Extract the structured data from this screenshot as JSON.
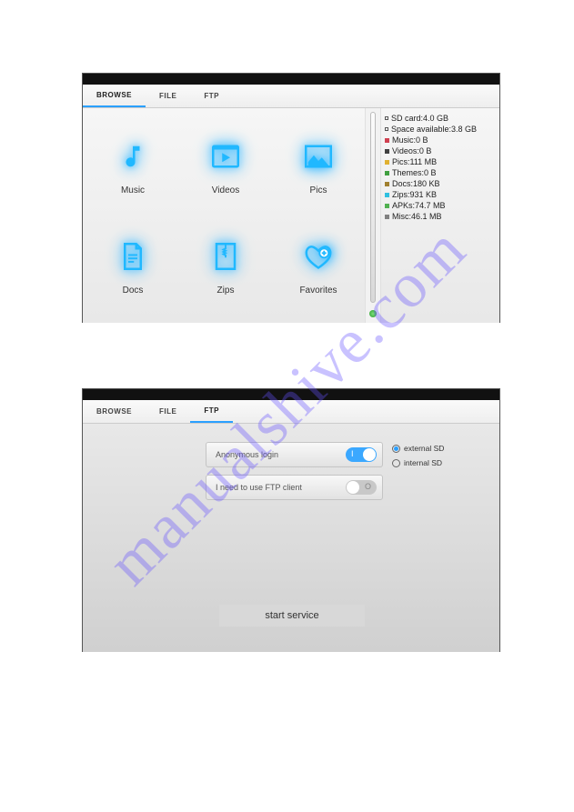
{
  "watermark": "manualshive.com",
  "tabs": {
    "browse": "BROWSE",
    "file": "FILE",
    "ftp": "FTP"
  },
  "categories": {
    "music": "Music",
    "videos": "Videos",
    "pics": "Pics",
    "docs": "Docs",
    "zips": "Zips",
    "favorites": "Favorites"
  },
  "storage": {
    "card": "SD card:4.0 GB",
    "avail": "Space available:3.8 GB",
    "items": [
      {
        "color": "#d04050",
        "text": "Music:0 B"
      },
      {
        "color": "#404040",
        "text": "Videos:0 B"
      },
      {
        "color": "#e0b030",
        "text": "Pics:111 MB"
      },
      {
        "color": "#40a040",
        "text": "Themes:0 B"
      },
      {
        "color": "#a08030",
        "text": "Docs:180 KB"
      },
      {
        "color": "#30c0e0",
        "text": "Zips:931 KB"
      },
      {
        "color": "#50b050",
        "text": "APKs:74.7 MB"
      },
      {
        "color": "#808080",
        "text": "Misc:46.1 MB"
      }
    ]
  },
  "ftp": {
    "anon": "Anonymous login",
    "anon_on": "I",
    "client": "I need to use FTP client",
    "client_off": "O",
    "ext": "external SD",
    "int": "internal SD",
    "start": "start service"
  }
}
